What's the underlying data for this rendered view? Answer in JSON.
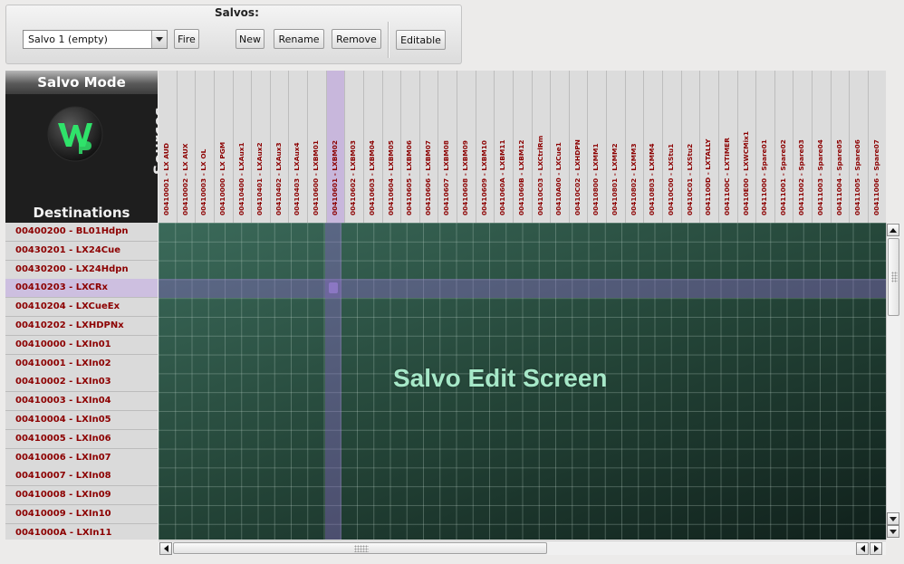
{
  "salvos": {
    "title": "Salvos:",
    "selected": "Salvo  1 (empty)",
    "fire_label": "Fire",
    "new_label": "New",
    "rename_label": "Rename",
    "remove_label": "Remove",
    "editable_label": "Editable"
  },
  "corner": {
    "mode_title": "Salvo Mode",
    "sources_label": "Sources",
    "destinations_label": "Destinations",
    "logo_text": "WHEATNET"
  },
  "sources": [
    "00410001 - LX AUD",
    "00410002 - LX AUX",
    "00410003 - LX OL",
    "00410000 - LX PGM",
    "00410400 - LXAux1",
    "00410401 - LXAux2",
    "00410402 - LXAux3",
    "00410403 - LXAux4",
    "00410600 - LXBM01",
    "00410601 - LXBM02",
    "00410602 - LXBM03",
    "00410603 - LXBM04",
    "00410604 - LXBM05",
    "00410605 - LXBM06",
    "00410606 - LXBM07",
    "00410607 - LXBM08",
    "00410608 - LXBM09",
    "00410609 - LXBM10",
    "0041060A - LXBM11",
    "0041060B - LXBM12",
    "00410C03 - LXCtrlRm",
    "00410A00 - LXCue1",
    "00410C02 - LXHDPN",
    "00410800 - LXMM1",
    "00410801 - LXMM2",
    "00410802 - LXMM3",
    "00410803 - LXMM4",
    "00410C00 - LXStu1",
    "00410C01 - LXStu2",
    "0041100D - LXTALLY",
    "0041100C - LXTIMER",
    "00410E00 - LXWCMix1",
    "00411000 - Spare01",
    "00411001 - Spare02",
    "00411002 - Spare03",
    "00411003 - Spare04",
    "00411004 - Spare05",
    "00411005 - Spare06",
    "00411006 - Spare07"
  ],
  "destinations": [
    "00400200 - BL01Hdpn",
    "00430201 - LX24Cue",
    "00430200 - LX24Hdpn",
    "00410203 - LXCRx",
    "00410204 - LXCueEx",
    "00410202 - LXHDPNx",
    "00410000 - LXIn01",
    "00410001 - LXIn02",
    "00410002 - LXIn03",
    "00410003 - LXIn04",
    "00410004 - LXIn05",
    "00410005 - LXIn06",
    "00410006 - LXIn07",
    "00410007 - LXIn08",
    "00410008 - LXIn09",
    "00410009 - LXIn10",
    "0041000A - LXIn11"
  ],
  "selected_source_index": 9,
  "selected_destination_index": 3,
  "grid_watermark": "Salvo Edit Screen",
  "colors": {
    "label_text": "#8c0000",
    "highlight": "#c8b7dc",
    "grid_dark": "#10201b",
    "grid_light": "#3b6a5a",
    "watermark": "#a6e8c8"
  }
}
